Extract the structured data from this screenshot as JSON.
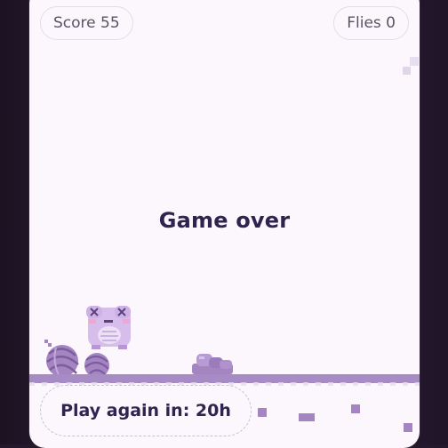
{
  "hud": {
    "score_label": "Score 55",
    "flies_label": "Flies 0"
  },
  "status": {
    "message": "Game over"
  },
  "controls": {
    "play_again_label": "Play again in: 20h"
  },
  "colors": {
    "accent": "#a485c2",
    "text_dark": "#2d2450",
    "card_bg": "#fbf7fc"
  },
  "sprites": {
    "player": "frog-knocked-out-icon",
    "obstacles": [
      "yarn-ball-icon",
      "yarn-ball-icon",
      "rock-pile-icon"
    ]
  }
}
